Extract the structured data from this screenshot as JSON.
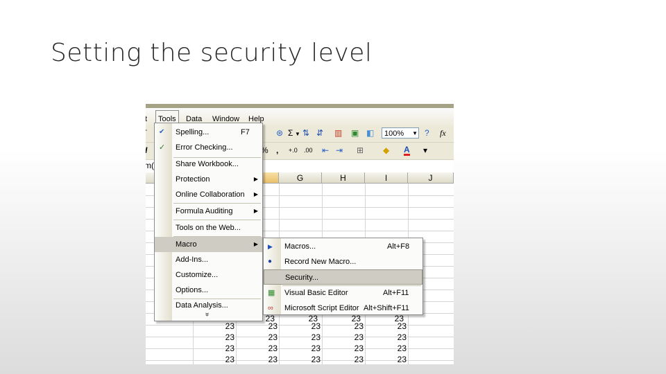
{
  "slide": {
    "title": "Setting the security level"
  },
  "menubar": {
    "items": [
      "t",
      "Tools",
      "Data",
      "Window",
      "Help"
    ]
  },
  "toolbar": {
    "sum_icon": "Σ",
    "zoom": "100%",
    "comma": ",",
    "font_color_letter": "A",
    "fx": "fx",
    "name_box_fragment": "m("
  },
  "columns": [
    "G",
    "H",
    "I",
    "J"
  ],
  "cell_value": "23",
  "tools_menu": {
    "items": [
      {
        "label": "Spelling...",
        "shortcut": "F7"
      },
      {
        "label": "Error Checking..."
      },
      {
        "label": "Share Workbook..."
      },
      {
        "label": "Protection"
      },
      {
        "label": "Online Collaboration"
      },
      {
        "label": "Formula Auditing"
      },
      {
        "label": "Tools on the Web..."
      },
      {
        "label": "Macro"
      },
      {
        "label": "Add-Ins..."
      },
      {
        "label": "Customize..."
      },
      {
        "label": "Options..."
      },
      {
        "label": "Data Analysis..."
      }
    ],
    "more": "»"
  },
  "macro_menu": {
    "items": [
      {
        "label": "Macros...",
        "shortcut": "Alt+F8"
      },
      {
        "label": "Record New Macro..."
      },
      {
        "label": "Security..."
      },
      {
        "label": "Visual Basic Editor",
        "shortcut": "Alt+F11"
      },
      {
        "label": "Microsoft Script Editor",
        "shortcut": "Alt+Shift+F11"
      }
    ]
  },
  "icons": {
    "spelling": "spelling-check-icon",
    "error": "error-checking-icon",
    "macros": "play-macro-icon",
    "record": "record-macro-icon",
    "vbe": "visual-basic-icon",
    "script": "script-editor-icon"
  }
}
